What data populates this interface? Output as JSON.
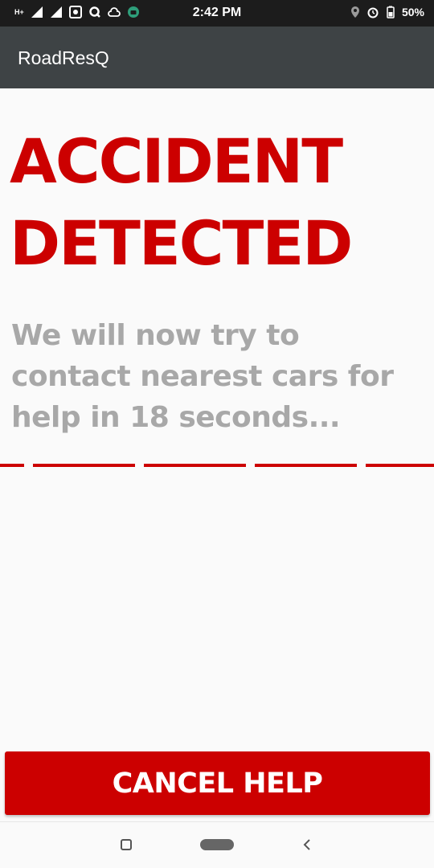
{
  "status_bar": {
    "time": "2:42 PM",
    "network_label": "H+",
    "battery": "50%",
    "icons_left": [
      "signal-icon",
      "signal-icon",
      "notification-icon",
      "q-icon",
      "cloud-icon",
      "android-icon"
    ],
    "icons_right": [
      "location-icon",
      "alarm-icon",
      "battery-icon"
    ]
  },
  "app_bar": {
    "title": "RoadResQ"
  },
  "main": {
    "headline_line1": "ACCIDENT",
    "headline_line2": "DETECTED",
    "message_line1": "We will now try to",
    "message_line2": "contact nearest cars for",
    "message_line3": "help in 18 seconds...",
    "countdown_seconds": 18,
    "countdown_segments": 5
  },
  "cancel_button": {
    "label": "CANCEL HELP"
  },
  "colors": {
    "accent": "#cc0000",
    "message": "#a8a8a8",
    "app_bar": "#3e4345",
    "status_bar": "#1c1c1c"
  },
  "nav_bar": {
    "icons": [
      "recents-icon",
      "home-icon",
      "back-icon"
    ]
  }
}
